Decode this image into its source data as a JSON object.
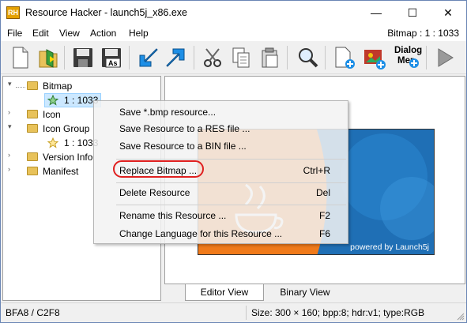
{
  "window": {
    "app_icon_text": "RH",
    "title": "Resource Hacker - launch5j_x86.exe",
    "minimize_glyph": "—",
    "maximize_glyph": "☐",
    "close_glyph": "✕"
  },
  "menu": {
    "items": [
      "File",
      "Edit",
      "View",
      "Action",
      "Help"
    ],
    "status": "Bitmap : 1 : 1033"
  },
  "toolbar": {
    "buttons": [
      "new-file-icon",
      "open-file-icon",
      "save-icon",
      "save-as-icon",
      "import-icon",
      "export-icon",
      "cut-icon",
      "copy-icon",
      "paste-icon",
      "search-icon",
      "add-resource-icon",
      "add-image-icon",
      "dialog-menu-icon",
      "run-icon"
    ],
    "dialog_menu_label_1": "Dialog",
    "dialog_menu_label_2": "Mer"
  },
  "tree": {
    "bitmap": "Bitmap",
    "bitmap_child": "1 : 1033",
    "icon": "Icon",
    "icon_group": "Icon Group",
    "icon_group_child": "1 : 1033",
    "version_info": "Version Info",
    "manifest": "Manifest"
  },
  "preview": {
    "image_caption": "powered by Launch5j",
    "image_colors": {
      "blue": "#1f6fb5",
      "orange": "#f07a1a"
    }
  },
  "tabs": {
    "editor": "Editor View",
    "binary": "Binary View"
  },
  "status": {
    "offsets": "BFA8 / C2F8",
    "info": "Size: 300 × 160;  bpp:8;  hdr:v1;  type:RGB"
  },
  "context_menu": {
    "items": [
      {
        "label": "Save *.bmp resource...",
        "shortcut": ""
      },
      {
        "label": "Save Resource to a RES file ...",
        "shortcut": ""
      },
      {
        "label": "Save Resource to a BIN file ...",
        "shortcut": ""
      },
      {
        "label": "Replace Bitmap ...",
        "shortcut": "Ctrl+R"
      },
      {
        "label": "Delete Resource",
        "shortcut": "Del"
      },
      {
        "label": "Rename this Resource ...",
        "shortcut": "F2"
      },
      {
        "label": "Change Language for this Resource ...",
        "shortcut": "F6"
      }
    ],
    "highlight_color": "#e02020"
  }
}
